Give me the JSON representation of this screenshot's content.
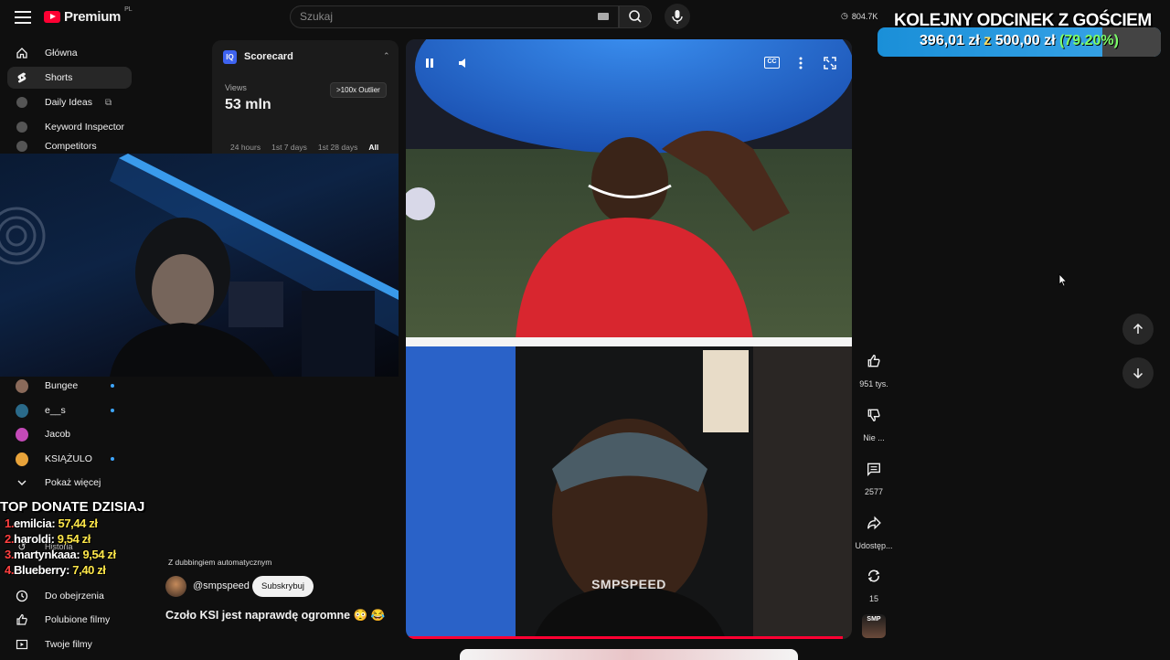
{
  "header": {
    "logo_text": "Premium",
    "logo_country": "PL",
    "search_placeholder": "Szukaj",
    "view_count": "804.7K"
  },
  "overlay": {
    "title": "KOLEJNY ODCINEK Z GOŚCIEM",
    "goal_current": "396,01 zł",
    "goal_sep": " z ",
    "goal_target": "500,00 zł",
    "goal_percent": "(79.20%)",
    "goal_fraction": 0.792
  },
  "sidebar": {
    "items": [
      {
        "label": "Główna",
        "icon": "home-icon"
      },
      {
        "label": "Shorts",
        "icon": "shorts-icon",
        "active": true
      },
      {
        "label": "Daily Ideas",
        "icon": "vidiq-icon"
      },
      {
        "label": "Keyword Inspector",
        "icon": "vidiq-icon"
      },
      {
        "label": "Competitors",
        "icon": "vidiq-icon"
      }
    ],
    "channels": [
      {
        "label": "Bungee",
        "color": "#8a6a5a",
        "live": true
      },
      {
        "label": "e__s",
        "color": "#2a6a8a",
        "live": true
      },
      {
        "label": "Jacob",
        "color": "#c44ab8",
        "live": false
      },
      {
        "label": "KSIĄŻULO",
        "color": "#e8a33a",
        "live": true
      }
    ],
    "show_more": "Pokaż więcej",
    "history": "Historia",
    "bottom": [
      {
        "label": "Do obejrzenia",
        "icon": "clock-icon"
      },
      {
        "label": "Polubione filmy",
        "icon": "thumb-up-icon"
      },
      {
        "label": "Twoje filmy",
        "icon": "play-square-icon"
      }
    ]
  },
  "scorecard": {
    "title": "Scorecard",
    "views_label": "Views",
    "views_value": "53 mln",
    "outlier": ">100x Outlier",
    "tabs": [
      "24 hours",
      "1st 7 days",
      "1st 28 days",
      "All"
    ],
    "active_tab": "All"
  },
  "donations": {
    "title": "TOP DONATE DZISIAJ",
    "rows": [
      {
        "rank": "1.",
        "user": "emilcia:",
        "amount": "57,44 zł"
      },
      {
        "rank": "2.",
        "user": "haroldi:",
        "amount": "9,54 zł"
      },
      {
        "rank": "3.",
        "user": "martynkaaa:",
        "amount": "9,54 zł"
      },
      {
        "rank": "4.",
        "user": "Blueberry:",
        "amount": "7,40 zł"
      }
    ]
  },
  "video": {
    "dubbing_note": "Z dubbingiem automatycznym",
    "channel_handle": "@smpspeed",
    "subscribe_label": "Subskrybuj",
    "title": "Czoło KSI jest naprawdę ogromne 😳 😂",
    "watermark": "SMPSPEED",
    "cc_label": "CC",
    "progress": 0.98
  },
  "actions": {
    "likes": "951 tys.",
    "dislike": "Nie ...",
    "comments": "2577",
    "share": "Udostęp...",
    "remix": "15",
    "avatar_text": "SMP"
  }
}
